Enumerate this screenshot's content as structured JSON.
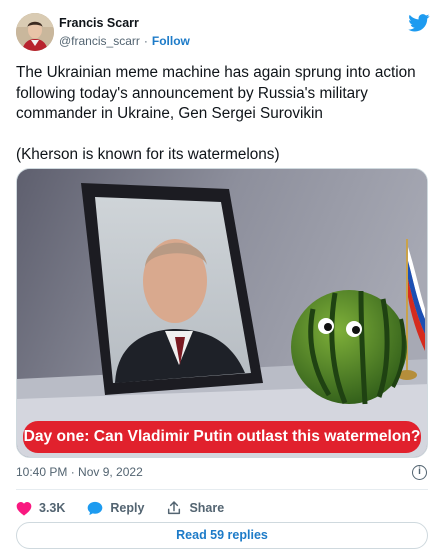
{
  "author": {
    "name": "Francis Scarr",
    "handle": "@francis_scarr",
    "separator": "·",
    "follow_label": "Follow"
  },
  "tweet": {
    "paragraphs": [
      "The Ukrainian meme machine has again sprung into action following today's announcement by Russia's military commander in Ukraine, Gen Sergei Surovikin",
      "(Kherson is known for its watermelons)"
    ],
    "media_caption": "Day one: Can Vladimir Putin outlast this watermelon?",
    "timestamp": "10:40 PM · Nov 9, 2022",
    "info_glyph": "i"
  },
  "actions": {
    "like_count": "3.3K",
    "reply_label": "Reply",
    "share_label": "Share"
  },
  "read_replies_label": "Read 59 replies",
  "icons": {
    "brand": "twitter-bird-icon",
    "like": "heart-icon",
    "reply": "speech-bubble-icon",
    "share": "share-arrow-icon",
    "info": "info-icon"
  },
  "colors": {
    "accent": "#1d7bc8",
    "like": "#f91880",
    "caption_bg": "#e1212d",
    "muted_text": "#536471"
  }
}
